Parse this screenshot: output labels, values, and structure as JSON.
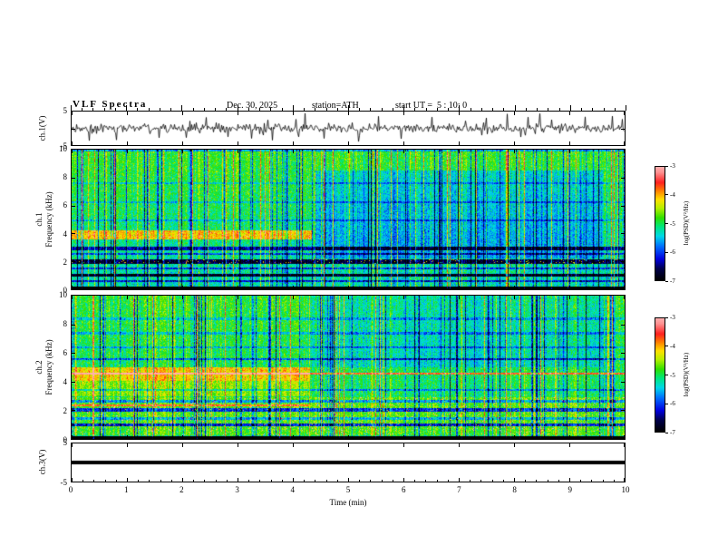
{
  "header": {
    "title": "VLF Spectra",
    "date": "Dec. 30, 2025",
    "station": "station=ATH",
    "start_ut": "start UT =  5 : 10: 0"
  },
  "axes": {
    "xlabel": "Time  (min)",
    "x_ticks": [
      "0",
      "1",
      "2",
      "3",
      "4",
      "5",
      "6",
      "7",
      "8",
      "9",
      "10"
    ],
    "wave1": {
      "ylabel": "ch.1(V)",
      "yticks": [
        "5",
        "-5"
      ]
    },
    "spec1": {
      "ylabel_line1": "ch.1",
      "ylabel_line2": "Frequency  (kHz)",
      "yticks": [
        "10",
        "8",
        "6",
        "4",
        "2",
        "0"
      ]
    },
    "spec2": {
      "ylabel_line1": "ch.2",
      "ylabel_line2": "Frequency  (kHz)",
      "yticks": [
        "10",
        "8",
        "6",
        "4",
        "2",
        "0"
      ]
    },
    "wave3": {
      "ylabel": "ch.3(V)",
      "yticks": [
        "5",
        "-5"
      ]
    },
    "colorbar": {
      "label": "log(PSD)(V²/Hz)",
      "ticks": [
        "-3",
        "-4",
        "-5",
        "-6",
        "-7"
      ]
    }
  },
  "colormap": {
    "zlim": [
      -7,
      -3
    ],
    "stops": [
      {
        "v": -7.0,
        "color": "#000000"
      },
      {
        "v": -6.6,
        "color": "#00004a"
      },
      {
        "v": -6.25,
        "color": "#0000e0"
      },
      {
        "v": -5.8,
        "color": "#0070ff"
      },
      {
        "v": -5.45,
        "color": "#00d8e8"
      },
      {
        "v": -5.1,
        "color": "#00e87a"
      },
      {
        "v": -4.8,
        "color": "#30e000"
      },
      {
        "v": -4.45,
        "color": "#b8f000"
      },
      {
        "v": -4.15,
        "color": "#ffe000"
      },
      {
        "v": -3.85,
        "color": "#ff8000"
      },
      {
        "v": -3.55,
        "color": "#ff2020"
      },
      {
        "v": -3.2,
        "color": "#ff9090"
      },
      {
        "v": -3.0,
        "color": "#ffb0b0"
      }
    ]
  },
  "chart_data": [
    {
      "type": "line",
      "name": "ch1-waveform",
      "ylabel": "ch.1(V)",
      "xlim": [
        0,
        10
      ],
      "ylim": [
        -5,
        5
      ],
      "yticks": [
        5,
        -5
      ],
      "description": "Channel-1 voltage time series: continuous broadband noise of roughly ±1 V about 0 V with frequent impulsive sferic spikes reaching about ±4 V over the full 0-10 min record.",
      "gen": {
        "seed": 77,
        "noise_amp": 0.65,
        "spike_prob": 0.07,
        "spike_amp": 3.0
      }
    },
    {
      "type": "heatmap",
      "name": "ch1-spectrogram",
      "xlim": [
        0,
        10
      ],
      "ylim": [
        0,
        10
      ],
      "xlabel": "Time  (min)",
      "ylabel": "ch.1  Frequency (kHz)",
      "zlim": [
        -7,
        -3
      ],
      "zlabel": "log(PSD)(V²/Hz)",
      "background_level": -5.05,
      "description": "Speckled green/cyan broadband background with dense vertical sferic streaks (yellow-red bright, navy-black dropouts). A strong emission band near 3.6-4.2 kHz lasts from 0 to ~4.35 min then vanishes; low-frequency dark horizontal bands near 0, 1, 2 and 3 kHz; quieter (bluer) 2-8 kHz region after ~4.4 min.",
      "gen": {
        "seed": 20251230,
        "noise": 0.5,
        "bright_col_prob": 0.09,
        "bright_col_amp": [
          0.6,
          1.8
        ],
        "dark_col_prob": 0.13,
        "dark_col_amp": [
          0.6,
          2.0
        ],
        "col_jitter": 0.35,
        "freq_tilt": 0.25
      },
      "bands": [
        {
          "f": [
            3.55,
            4.2
          ],
          "t": [
            0,
            4.35
          ],
          "dv": 1.05,
          "speckle_prob": 0.04,
          "speckle_amp": 1.5
        },
        {
          "f": [
            0.0,
            0.22
          ],
          "dv": -2.6
        },
        {
          "f": [
            0.5,
            0.68
          ],
          "dv": -0.9
        },
        {
          "f": [
            0.92,
            1.12
          ],
          "dv": -1.6
        },
        {
          "f": [
            1.42,
            1.58
          ],
          "dv": -0.8
        },
        {
          "f": [
            1.85,
            2.15
          ],
          "dv": -1.5,
          "speckle_prob": 0.05,
          "speckle_amp": 2.6
        },
        {
          "f": [
            2.45,
            2.6
          ],
          "dv": -0.8
        },
        {
          "f": [
            2.82,
            3.05
          ],
          "dv": -1.2
        },
        {
          "f": [
            4.9,
            5.02
          ],
          "dv": -0.5
        },
        {
          "f": [
            6.15,
            6.27
          ],
          "dv": -0.5
        },
        {
          "f": [
            7.55,
            7.66
          ],
          "dv": -0.45
        },
        {
          "f": [
            9.9,
            10.0
          ],
          "dv": -0.8
        }
      ],
      "regions": [
        {
          "f": [
            2.2,
            8.5
          ],
          "t": [
            4.4,
            9.6
          ],
          "dv": -0.45
        }
      ]
    },
    {
      "type": "heatmap",
      "name": "ch2-spectrogram",
      "xlim": [
        0,
        10
      ],
      "ylim": [
        0,
        10
      ],
      "xlabel": "Time  (min)",
      "ylabel": "ch.2  Frequency (kHz)",
      "zlim": [
        -7,
        -3
      ],
      "zlabel": "log(PSD)(V²/Hz)",
      "background_level": -5.0,
      "description": "Similar speckled background with vertical sferic streaks. Enhanced yellow-green emission between 3 and 5 kHz until ~4.3 min, a persistent narrow red line near 4.55 kHz across the whole record, generally enhanced low-frequency (0.3-3 kHz) background, dark bands near 0, 1, 2 kHz, and a slightly quieter upper half after ~4.3 min.",
      "gen": {
        "seed": 510,
        "noise": 0.5,
        "bright_col_prob": 0.08,
        "bright_col_amp": [
          0.6,
          1.6
        ],
        "dark_col_prob": 0.12,
        "dark_col_amp": [
          0.6,
          1.9
        ],
        "col_jitter": 0.35,
        "freq_tilt": 0.15
      },
      "bands": [
        {
          "f": [
            4.05,
            5.0
          ],
          "t": [
            0,
            4.3
          ],
          "dv": 0.9
        },
        {
          "f": [
            3.0,
            4.05
          ],
          "t": [
            0,
            4.3
          ],
          "dv": 0.5
        },
        {
          "f": [
            4.5,
            4.63
          ],
          "dv": 1.4,
          "speckle_prob": 0.05,
          "speckle_amp": 1.2
        },
        {
          "f": [
            2.28,
            2.38
          ],
          "t": [
            0,
            4.3
          ],
          "dv": 1.1
        },
        {
          "f": [
            0.25,
            2.9
          ],
          "dv": 0.35,
          "speckle_prob": 0.03,
          "speckle_amp": 2.2
        },
        {
          "f": [
            0.0,
            0.22
          ],
          "dv": -2.6
        },
        {
          "f": [
            0.9,
            1.1
          ],
          "dv": -1.4
        },
        {
          "f": [
            1.35,
            1.5
          ],
          "dv": -0.8
        },
        {
          "f": [
            1.9,
            2.15
          ],
          "dv": -1.3
        },
        {
          "f": [
            2.55,
            2.7
          ],
          "dv": -0.9
        },
        {
          "f": [
            3.35,
            3.5
          ],
          "dv": -0.7
        },
        {
          "f": [
            5.5,
            5.65
          ],
          "dv": -0.9
        },
        {
          "f": [
            6.3,
            6.45
          ],
          "dv": -0.6
        },
        {
          "f": [
            7.3,
            7.45
          ],
          "dv": -0.55
        },
        {
          "f": [
            8.3,
            8.45
          ],
          "dv": -0.5
        }
      ],
      "regions": [
        {
          "f": [
            5.0,
            10.0
          ],
          "t": [
            4.3,
            9.6
          ],
          "dv": -0.35
        }
      ]
    },
    {
      "type": "line",
      "name": "ch3-waveform",
      "ylabel": "ch.3(V)",
      "xlim": [
        0,
        10
      ],
      "ylim": [
        -5,
        5
      ],
      "yticks": [
        5,
        -5
      ],
      "value": 0,
      "description": "Flat thick trace at 0 V for the entire record (channel inactive)."
    }
  ]
}
